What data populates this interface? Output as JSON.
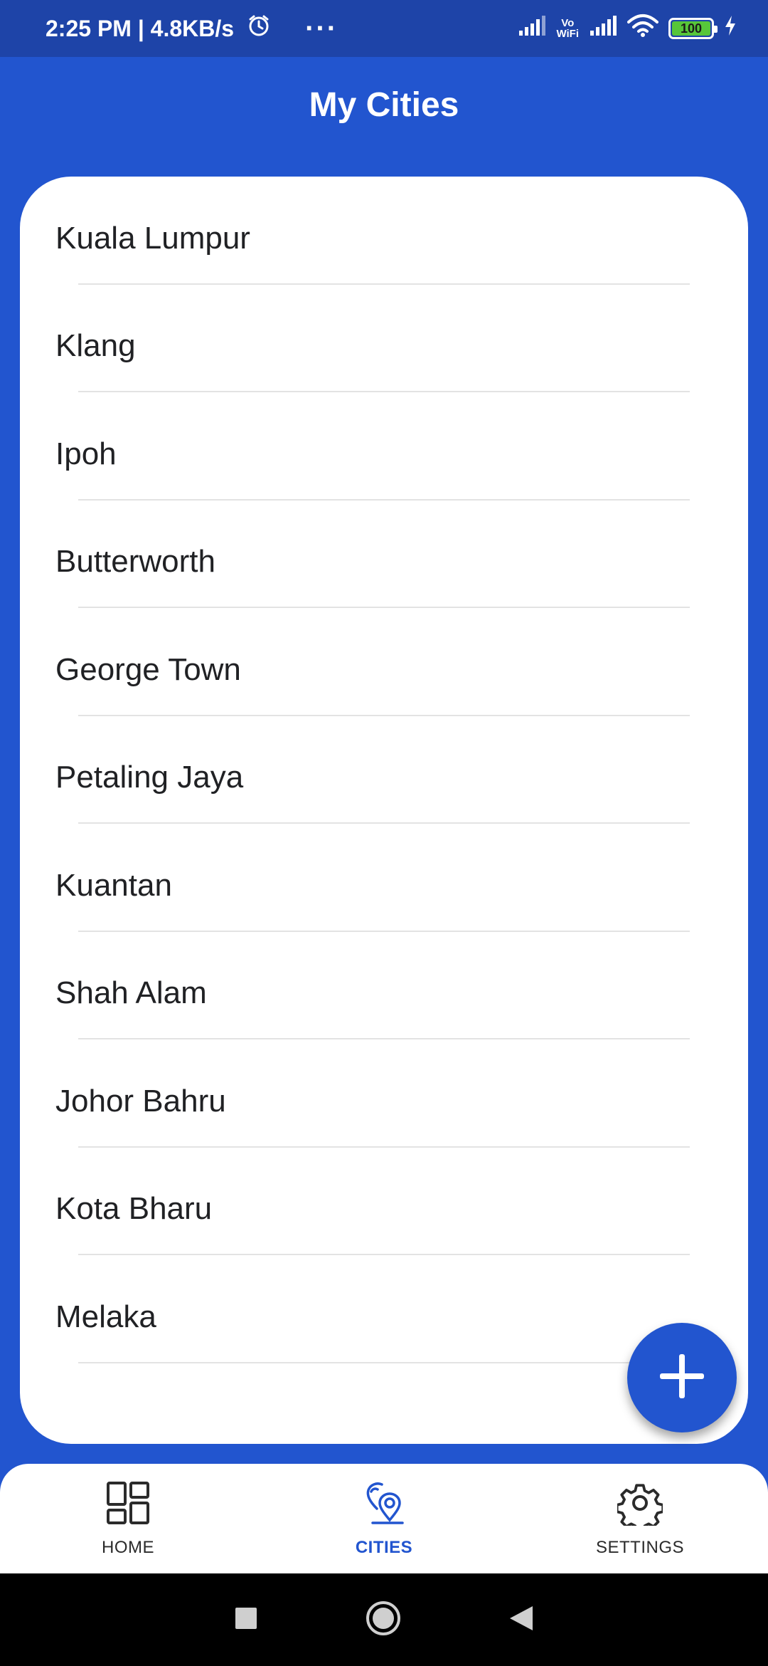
{
  "status_bar": {
    "time_speed": "2:25 PM | 4.8KB/s",
    "more": "···",
    "vowifi": "Vo\nWiFi",
    "battery": "100"
  },
  "header": {
    "title": "My Cities"
  },
  "cities": [
    "Kuala Lumpur",
    "Klang",
    "Ipoh",
    "Butterworth",
    "George Town",
    "Petaling Jaya",
    "Kuantan",
    "Shah Alam",
    "Johor Bahru",
    "Kota Bharu",
    "Melaka"
  ],
  "fab": {
    "icon": "plus-icon"
  },
  "bottom_nav": {
    "items": [
      {
        "label": "HOME",
        "icon": "grid-icon",
        "active": false
      },
      {
        "label": "CITIES",
        "icon": "location-pin-icon",
        "active": true
      },
      {
        "label": "SETTINGS",
        "icon": "gear-icon",
        "active": false
      }
    ]
  },
  "colors": {
    "primary": "#2255CF",
    "status_bar": "#1E44A8",
    "battery": "#57C63A"
  }
}
